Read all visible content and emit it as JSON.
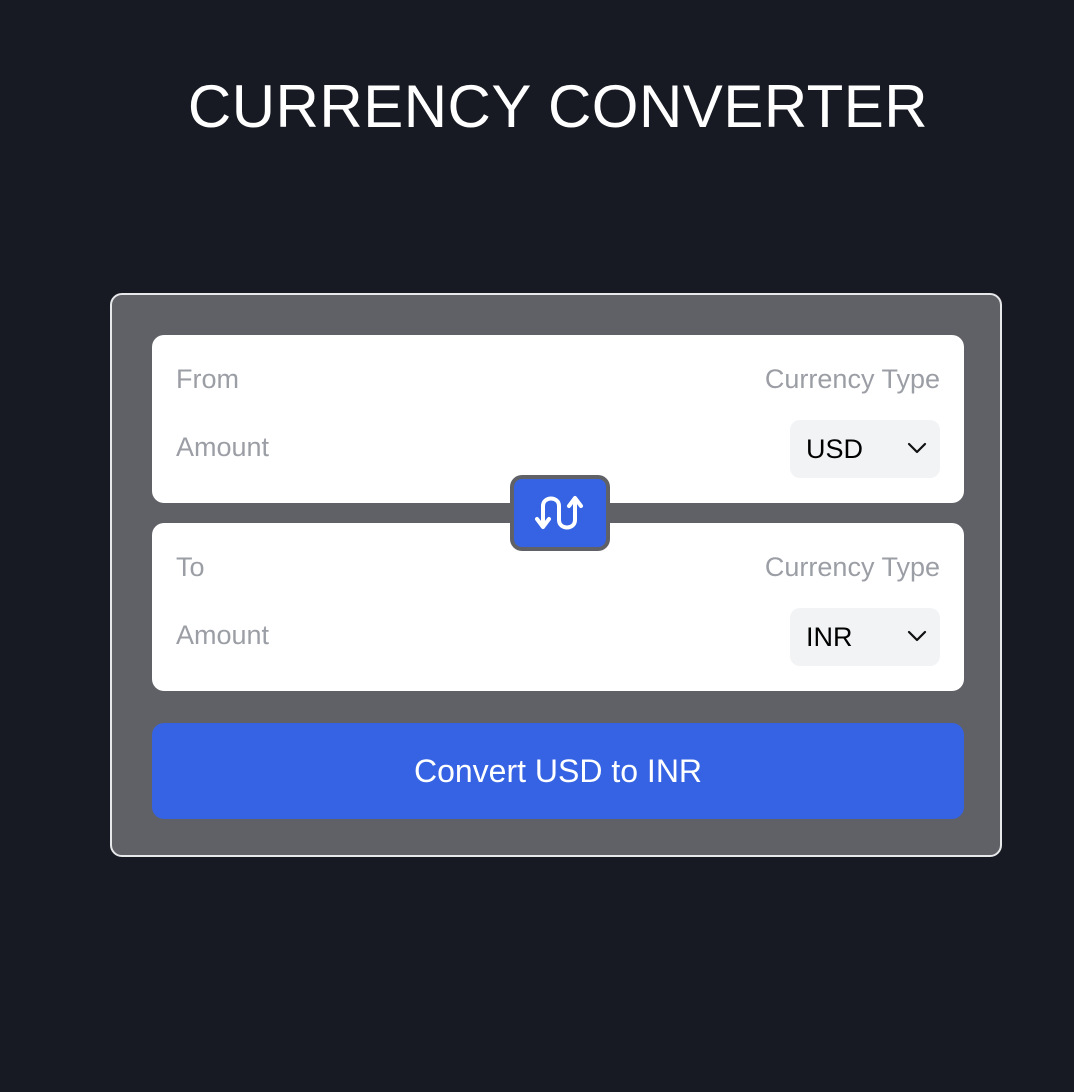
{
  "app": {
    "title": "CURRENCY CONVERTER"
  },
  "from": {
    "direction_label": "From",
    "amount_label": "Amount",
    "amount_value": "",
    "currency_type_label": "Currency Type",
    "currency_selected": "USD"
  },
  "to": {
    "direction_label": "To",
    "amount_label": "Amount",
    "amount_value": "",
    "currency_type_label": "Currency Type",
    "currency_selected": "INR"
  },
  "swap": {
    "icon": "swap-vertical-arrows-icon"
  },
  "convert_button": {
    "label": "Convert USD to INR"
  },
  "colors": {
    "background": "#171a22",
    "card": "#606166",
    "panel": "#ffffff",
    "accent": "#3563e3",
    "muted_text": "#9b9ea5"
  }
}
